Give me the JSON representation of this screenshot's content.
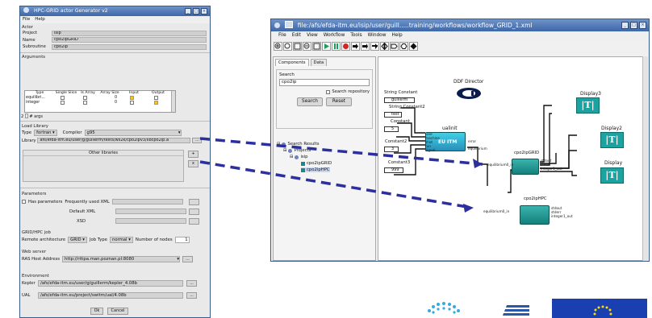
{
  "generator": {
    "title": "HPC-GRID actor Generator v2",
    "menu": [
      "File",
      "Help"
    ],
    "actor_section": "Actor",
    "fields": [
      {
        "label": "Project",
        "value": "isip"
      },
      {
        "label": "Name",
        "value": "cpo2ipGRID"
      },
      {
        "label": "Subroutine",
        "value": "cpo2ip"
      }
    ],
    "arguments_section": "Arguments",
    "args_headers": [
      "Type",
      "Single Slice",
      "Is Array",
      "Array Size",
      "Input",
      "Output"
    ],
    "args_rows": [
      {
        "type": "equilibri...",
        "array_size": "0",
        "input": true,
        "output": false
      },
      {
        "type": "integer",
        "array_size": "0",
        "input": false,
        "output": true
      }
    ],
    "num_args": "2",
    "num_args_label": "# args",
    "load_library_section": "Load Library",
    "type_label": "Type",
    "type_value": "fortran",
    "compiler_label": "Compiler",
    "compiler_value": "g95",
    "library_label": "Library",
    "library_value": "afs/efda-itm.eu/user/g/guillerm/tests/ws2k/cpo2ipv3/libcpo2ip.a",
    "other_libraries": "Other libraries",
    "plus_label": "+",
    "x_label": "x",
    "parameters_section": "Parameters",
    "has_params_label": "Has parameters",
    "freq_xml_label": "Frequently used XML",
    "default_xml_label": "Default XML",
    "xsd_label": "XSD",
    "grid_section": "GRID/HPC job",
    "remote_arch_label": "Remote architecture",
    "remote_arch_value": "GRID",
    "job_type_label": "Job Type",
    "job_type_value": "normal",
    "num_nodes_label": "Number of nodes",
    "num_nodes_value": "1",
    "web_server_section": "Web server",
    "ras_label": "RAS Host Address",
    "ras_value": "http://ritipa.man.poznan.pl:8080",
    "environment_section": "Environment",
    "kepler_label": "Kepler",
    "kepler_value": "/afs/efda-itm.eu/user/g/guillerm/kepler_4.08b",
    "ual_label": "UAL",
    "ual_value": "/afs/efda-itm.eu/project/switm/ual/4.08b",
    "browse_label": "...",
    "ok_label": "Ok",
    "cancel_label": "Cancel"
  },
  "kepler": {
    "title": "file:/afs/efda-itm.eu/isip/user/guill.....training/workflows/workflow_GRID_1.xml",
    "menu": [
      "File",
      "Edit",
      "View",
      "Workflow",
      "Tools",
      "Window",
      "Help"
    ],
    "tabs": [
      "Components",
      "Data"
    ],
    "search_label": "Search",
    "search_value": "cpo2ip",
    "search_repo_label": "Search repository",
    "search_button": "Search",
    "reset_button": "Reset",
    "tree": [
      "Search Results",
      "Projects",
      "isip",
      "cpo2ipGRID",
      "cpo2ipHPC"
    ],
    "director_label": "DDF Director",
    "constants": [
      {
        "name": "String Constant",
        "value": "guillerm"
      },
      {
        "name": "String Constant2",
        "value": "test"
      },
      {
        "name": "Constant",
        "value": "5"
      },
      {
        "name": "Constant2",
        "value": "3"
      },
      {
        "name": "Constant3",
        "value": "999"
      }
    ],
    "ualinit": {
      "name": "ualinit",
      "inner": "EU ITM",
      "ports_in": [
        "user",
        "machine",
        "shot",
        "run",
        "signal"
      ],
      "ports_out": [
        "error",
        "equilibrium"
      ]
    },
    "grid_actor": {
      "name": "cpo2ipGRID",
      "port_in": "equilibrium0_in",
      "ports_out": [
        "stdout",
        "stderr",
        "integer1_out"
      ]
    },
    "hpc_actor": {
      "name": "cpo2ipHPC",
      "port_in": "equilibrium0_in",
      "ports_out": [
        "stdout",
        "stderr",
        "integer1_out"
      ]
    },
    "displays": [
      {
        "name": "Display3",
        "glyph": "|T|"
      },
      {
        "name": "Display2",
        "glyph": "|T|"
      },
      {
        "name": "Display",
        "glyph": "|T|"
      }
    ]
  }
}
